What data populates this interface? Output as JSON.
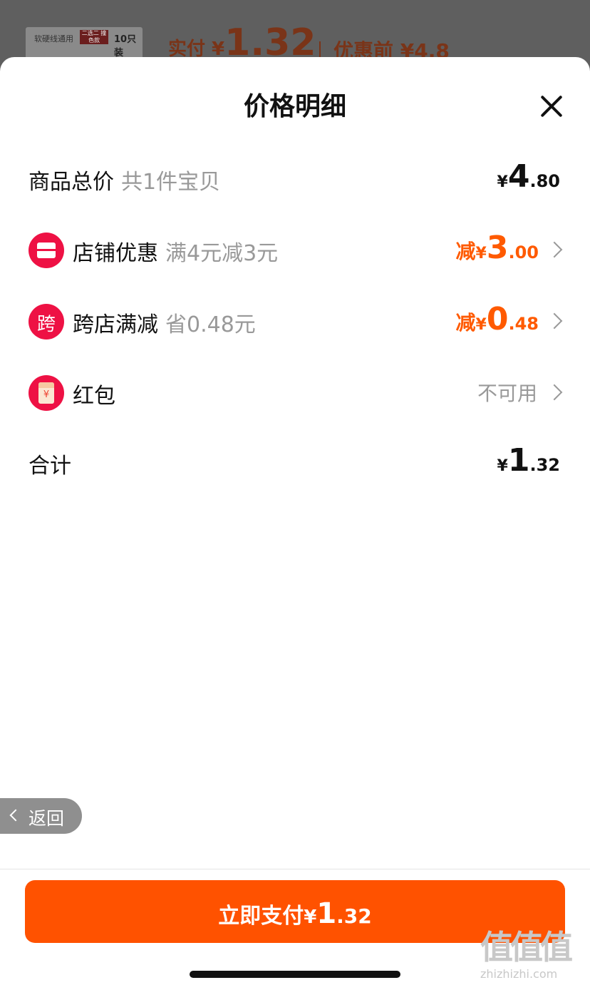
{
  "background": {
    "card_text": "软硬线通用",
    "card_badge": "二选二 撞色款",
    "card_count": "10只装",
    "paid_label": "实付 ¥",
    "paid_value": "1.32",
    "original_label": "优惠前 ¥4.8"
  },
  "sheet": {
    "title": "价格明细",
    "close_icon": "close-icon"
  },
  "rows": {
    "total": {
      "label": "商品总价",
      "sub": "共1件宝贝",
      "yen": "¥",
      "int": "4",
      "dec": ".80"
    },
    "shop_discount": {
      "icon": "shop-icon",
      "label": "店铺优惠",
      "sub": "满4元减3元",
      "prefix": "减",
      "yen": "¥",
      "int": "3",
      "dec": ".00"
    },
    "cross_store": {
      "icon_text": "跨",
      "label": "跨店满减",
      "sub": "省0.48元",
      "prefix": "减",
      "yen": "¥",
      "int": "0",
      "dec": ".48"
    },
    "red_packet": {
      "icon": "red-packet-icon",
      "icon_text": "¥",
      "label": "红包",
      "status": "不可用"
    },
    "sum": {
      "label": "合计",
      "yen": "¥",
      "int": "1",
      "dec": ".32"
    }
  },
  "back": {
    "label": "返回"
  },
  "pay_button": {
    "label": "立即支付",
    "yen": "¥",
    "int": "1",
    "dec": ".32"
  },
  "watermark": {
    "big": "值值值",
    "small": "zhizhizhi.com"
  },
  "colors": {
    "accent": "#ff5200",
    "discount": "#ff5a00",
    "icon_red": "#ee1144",
    "muted": "#999999"
  }
}
